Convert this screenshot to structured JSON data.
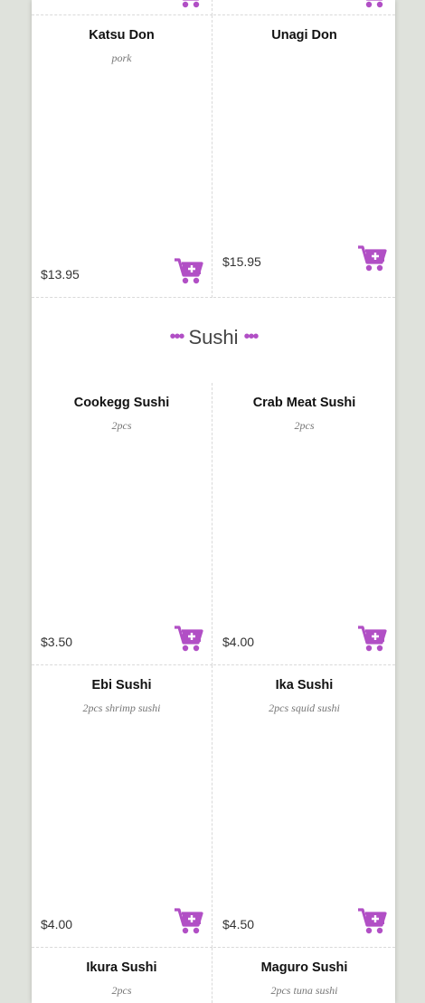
{
  "colors": {
    "accent": "#b14fc5",
    "background": "#dfe2dc",
    "panel": "#ffffff"
  },
  "icons": {
    "cart": "cart-plus-icon",
    "dots": "ellipsis-icon"
  },
  "sections": [
    {
      "title": "",
      "items": [
        {
          "name": "Katsu Don",
          "desc": "pork",
          "price": "$13.95"
        },
        {
          "name": "Unagi Don",
          "desc": "",
          "price": "$15.95"
        }
      ]
    },
    {
      "title": "Sushi",
      "items": [
        {
          "name": "Cookegg Sushi",
          "desc": "2pcs",
          "price": "$3.50"
        },
        {
          "name": "Crab Meat Sushi",
          "desc": "2pcs",
          "price": "$4.00"
        },
        {
          "name": "Ebi Sushi",
          "desc": "2pcs shrimp sushi",
          "price": "$4.00"
        },
        {
          "name": "Ika Sushi",
          "desc": "2pcs squid sushi",
          "price": "$4.50"
        },
        {
          "name": "Ikura Sushi",
          "desc": "2pcs",
          "price": ""
        },
        {
          "name": "Maguro Sushi",
          "desc": "2pcs tuna sushi",
          "price": ""
        }
      ]
    }
  ]
}
